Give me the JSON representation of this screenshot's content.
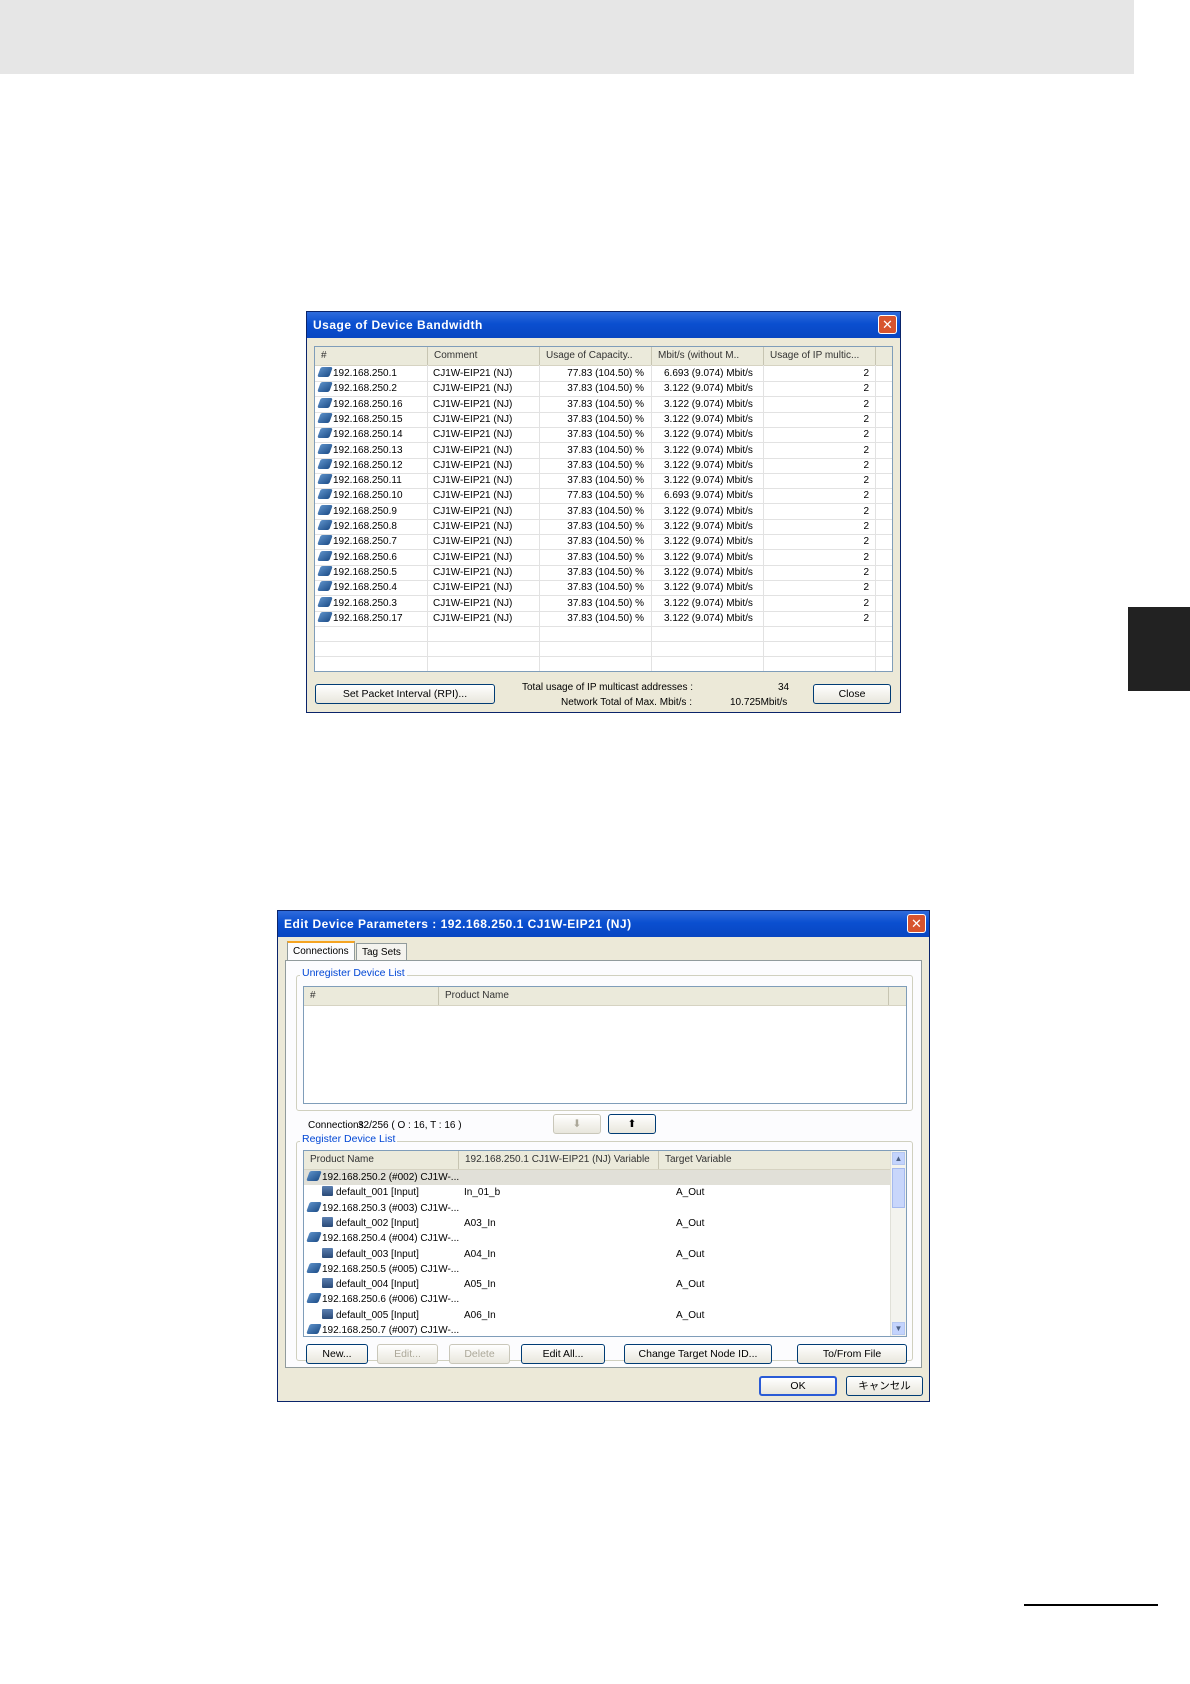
{
  "bandwidth_dialog": {
    "title": "Usage of Device Bandwidth",
    "columns": [
      "#",
      "Comment",
      "Usage of Capacity..",
      "Mbit/s (without M..",
      "Usage of IP multic..."
    ],
    "rows": [
      {
        "ip": "192.168.250.1",
        "comment": "CJ1W-EIP21 (NJ)",
        "usage": "77.83 (104.50) %",
        "mbits": "6.693 (9.074) Mbit/s",
        "mcast": "2"
      },
      {
        "ip": "192.168.250.2",
        "comment": "CJ1W-EIP21 (NJ)",
        "usage": "37.83 (104.50) %",
        "mbits": "3.122 (9.074) Mbit/s",
        "mcast": "2"
      },
      {
        "ip": "192.168.250.16",
        "comment": "CJ1W-EIP21 (NJ)",
        "usage": "37.83 (104.50) %",
        "mbits": "3.122 (9.074) Mbit/s",
        "mcast": "2"
      },
      {
        "ip": "192.168.250.15",
        "comment": "CJ1W-EIP21 (NJ)",
        "usage": "37.83 (104.50) %",
        "mbits": "3.122 (9.074) Mbit/s",
        "mcast": "2"
      },
      {
        "ip": "192.168.250.14",
        "comment": "CJ1W-EIP21 (NJ)",
        "usage": "37.83 (104.50) %",
        "mbits": "3.122 (9.074) Mbit/s",
        "mcast": "2"
      },
      {
        "ip": "192.168.250.13",
        "comment": "CJ1W-EIP21 (NJ)",
        "usage": "37.83 (104.50) %",
        "mbits": "3.122 (9.074) Mbit/s",
        "mcast": "2"
      },
      {
        "ip": "192.168.250.12",
        "comment": "CJ1W-EIP21 (NJ)",
        "usage": "37.83 (104.50) %",
        "mbits": "3.122 (9.074) Mbit/s",
        "mcast": "2"
      },
      {
        "ip": "192.168.250.11",
        "comment": "CJ1W-EIP21 (NJ)",
        "usage": "37.83 (104.50) %",
        "mbits": "3.122 (9.074) Mbit/s",
        "mcast": "2"
      },
      {
        "ip": "192.168.250.10",
        "comment": "CJ1W-EIP21 (NJ)",
        "usage": "77.83 (104.50) %",
        "mbits": "6.693 (9.074) Mbit/s",
        "mcast": "2"
      },
      {
        "ip": "192.168.250.9",
        "comment": "CJ1W-EIP21 (NJ)",
        "usage": "37.83 (104.50) %",
        "mbits": "3.122 (9.074) Mbit/s",
        "mcast": "2"
      },
      {
        "ip": "192.168.250.8",
        "comment": "CJ1W-EIP21 (NJ)",
        "usage": "37.83 (104.50) %",
        "mbits": "3.122 (9.074) Mbit/s",
        "mcast": "2"
      },
      {
        "ip": "192.168.250.7",
        "comment": "CJ1W-EIP21 (NJ)",
        "usage": "37.83 (104.50) %",
        "mbits": "3.122 (9.074) Mbit/s",
        "mcast": "2"
      },
      {
        "ip": "192.168.250.6",
        "comment": "CJ1W-EIP21 (NJ)",
        "usage": "37.83 (104.50) %",
        "mbits": "3.122 (9.074) Mbit/s",
        "mcast": "2"
      },
      {
        "ip": "192.168.250.5",
        "comment": "CJ1W-EIP21 (NJ)",
        "usage": "37.83 (104.50) %",
        "mbits": "3.122 (9.074) Mbit/s",
        "mcast": "2"
      },
      {
        "ip": "192.168.250.4",
        "comment": "CJ1W-EIP21 (NJ)",
        "usage": "37.83 (104.50) %",
        "mbits": "3.122 (9.074) Mbit/s",
        "mcast": "2"
      },
      {
        "ip": "192.168.250.3",
        "comment": "CJ1W-EIP21 (NJ)",
        "usage": "37.83 (104.50) %",
        "mbits": "3.122 (9.074) Mbit/s",
        "mcast": "2"
      },
      {
        "ip": "192.168.250.17",
        "comment": "CJ1W-EIP21 (NJ)",
        "usage": "37.83 (104.50) %",
        "mbits": "3.122 (9.074) Mbit/s",
        "mcast": "2"
      }
    ],
    "set_packet_button": "Set Packet Interval (RPI)...",
    "total_multicast_label": "Total usage of IP multicast addresses :",
    "total_multicast_value": "34",
    "network_total_label": "Network Total of Max. Mbit/s :",
    "network_total_value": "10.725Mbit/s",
    "close_button": "Close"
  },
  "edit_dialog": {
    "title": "Edit Device Parameters : 192.168.250.1 CJ1W-EIP21 (NJ)",
    "tabs": [
      "Connections",
      "Tag Sets"
    ],
    "unregister_legend": "Unregister Device List",
    "unregister_columns": [
      "#",
      "Product Name"
    ],
    "connections_label": "Connections :",
    "connections_value": "32/256 ( O : 16, T : 16 )",
    "register_legend": "Register Device List",
    "register_columns": [
      "Product Name",
      "192.168.250.1 CJ1W-EIP21 (NJ) Variable",
      "Target Variable"
    ],
    "register_rows": [
      {
        "kind": "device",
        "name": "192.168.250.2 (#002) CJ1W-...",
        "var": "",
        "target": ""
      },
      {
        "kind": "tag",
        "name": "default_001 [Input]",
        "var": "In_01_b",
        "target": "A_Out"
      },
      {
        "kind": "device",
        "name": "192.168.250.3 (#003) CJ1W-...",
        "var": "",
        "target": ""
      },
      {
        "kind": "tag",
        "name": "default_002 [Input]",
        "var": "A03_In",
        "target": "A_Out"
      },
      {
        "kind": "device",
        "name": "192.168.250.4 (#004) CJ1W-...",
        "var": "",
        "target": ""
      },
      {
        "kind": "tag",
        "name": "default_003 [Input]",
        "var": "A04_In",
        "target": "A_Out"
      },
      {
        "kind": "device",
        "name": "192.168.250.5 (#005) CJ1W-...",
        "var": "",
        "target": ""
      },
      {
        "kind": "tag",
        "name": "default_004 [Input]",
        "var": "A05_In",
        "target": "A_Out"
      },
      {
        "kind": "device",
        "name": "192.168.250.6 (#006) CJ1W-...",
        "var": "",
        "target": ""
      },
      {
        "kind": "tag",
        "name": "default_005 [Input]",
        "var": "A06_In",
        "target": "A_Out"
      },
      {
        "kind": "device",
        "name": "192.168.250.7 (#007) CJ1W-...",
        "var": "",
        "target": ""
      }
    ],
    "buttons": {
      "new": "New...",
      "edit": "Edit...",
      "delete": "Delete",
      "edit_all": "Edit All...",
      "change_target": "Change Target Node ID...",
      "to_from_file": "To/From File",
      "ok": "OK",
      "cancel": "キャンセル"
    }
  }
}
